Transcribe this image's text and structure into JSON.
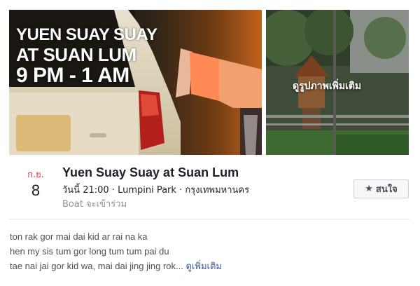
{
  "cover": {
    "overlay_lines": [
      "YUEN SUAY SUAY",
      "AT SUAN LUM",
      "9 PM - 1 AM"
    ],
    "more_photos_label": "ดูรูปภาพเพิ่มเติม"
  },
  "event": {
    "month": "ก.ย.",
    "day": "8",
    "title": "Yuen Suay Suay at Suan Lum",
    "meta": "วันนี้ 21:00 · Lumpini Park · กรุงเทพมหานคร",
    "going": "Boat จะเข้าร่วม",
    "interest_label": "สนใจ",
    "interest_icon": "star-icon"
  },
  "description": {
    "lines": [
      "ton rak gor mai dai kid ar rai na ka",
      "hen my sis tum gor long tum tum pai du",
      "tae nai jai gor kid wa, mai dai jing jing rok..."
    ],
    "see_more": "ดูเพิ่มเติม"
  },
  "colors": {
    "month_red": "#e0393e",
    "link_blue": "#365899",
    "text_dark": "#1d2129",
    "text_grey": "#90949c"
  }
}
